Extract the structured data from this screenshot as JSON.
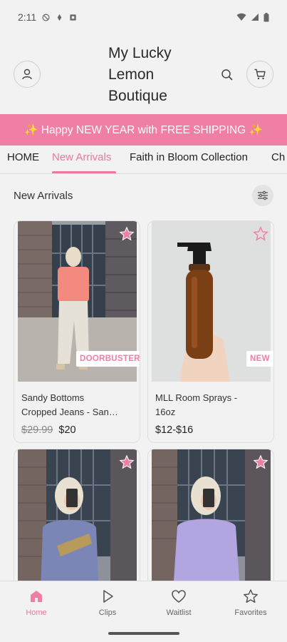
{
  "status_bar": {
    "time": "2:11"
  },
  "header": {
    "brand_line1": "My Lucky",
    "brand_line2": "Lemon",
    "brand_line3": "Boutique"
  },
  "promo": {
    "text": "✨ Happy NEW YEAR with FREE SHIPPING ✨"
  },
  "tabs": [
    {
      "label": "HOME"
    },
    {
      "label": "New Arrivals",
      "active": true
    },
    {
      "label": "Faith in Bloom Collection"
    },
    {
      "label": "Ch"
    }
  ],
  "section": {
    "title": "New Arrivals"
  },
  "products": [
    {
      "name_line1": "Sandy Bottoms",
      "name_line2": "Cropped Jeans - San…",
      "old_price": "$29.99",
      "price": "$20",
      "badge": "DOORBUSTER",
      "favorited": true
    },
    {
      "name_line1": "MLL Room Sprays -",
      "name_line2": "16oz",
      "price": "$12-$16",
      "badge": "NEW",
      "favorited": false
    },
    {
      "favorited": true
    },
    {
      "favorited": true
    }
  ],
  "bottom_nav": [
    {
      "label": "Home",
      "icon": "home-icon",
      "active": true
    },
    {
      "label": "Clips",
      "icon": "play-icon"
    },
    {
      "label": "Waitlist",
      "icon": "heart-icon"
    },
    {
      "label": "Favorites",
      "icon": "star-icon"
    }
  ],
  "colors": {
    "accent": "#f07fa6",
    "tab_active": "#e8799f",
    "background": "#f2f2f2"
  }
}
